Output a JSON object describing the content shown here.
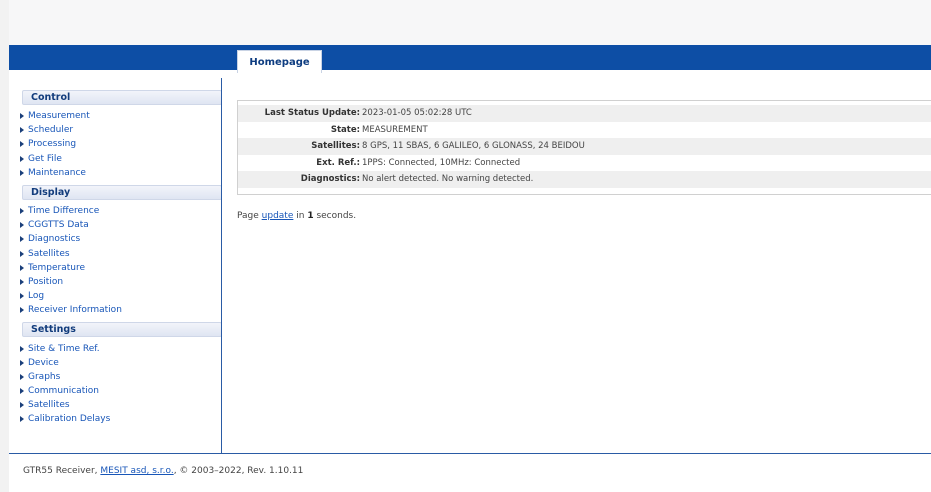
{
  "header": {
    "tab_label": "Homepage"
  },
  "sidebar": {
    "sections": [
      {
        "title": "Control",
        "items": [
          "Measurement",
          "Scheduler",
          "Processing",
          "Get File",
          "Maintenance"
        ]
      },
      {
        "title": "Display",
        "items": [
          "Time Difference",
          "CGGTTS Data",
          "Diagnostics",
          "Satellites",
          "Temperature",
          "Position",
          "Log",
          "Receiver Information"
        ]
      },
      {
        "title": "Settings",
        "items": [
          "Site & Time Ref.",
          "Device",
          "Graphs",
          "Communication",
          "Satellites",
          "Calibration Delays"
        ]
      }
    ]
  },
  "status": {
    "rows": [
      {
        "label": "Last Status Update:",
        "value": "2023-01-05 05:02:28 UTC"
      },
      {
        "label": "State:",
        "value": "MEASUREMENT"
      },
      {
        "label": "Satellites:",
        "value": "8 GPS, 11 SBAS, 6 GALILEO, 6 GLONASS, 24 BEIDOU"
      },
      {
        "label": "Ext. Ref.:",
        "value": "1PPS: Connected, 10MHz: Connected"
      },
      {
        "label": "Diagnostics:",
        "value": "No alert detected. No warning detected."
      }
    ]
  },
  "update": {
    "prefix": "Page ",
    "link": "update",
    "middle": " in ",
    "seconds": "1",
    "suffix": " seconds."
  },
  "footer": {
    "prefix": "GTR55 Receiver, ",
    "link": "MESIT asd, s.r.o.",
    "suffix": ", © 2003–2022, Rev. 1.10.11"
  },
  "colors": {
    "brand_blue": "#0d4ea5",
    "link_blue": "#1856b8"
  }
}
